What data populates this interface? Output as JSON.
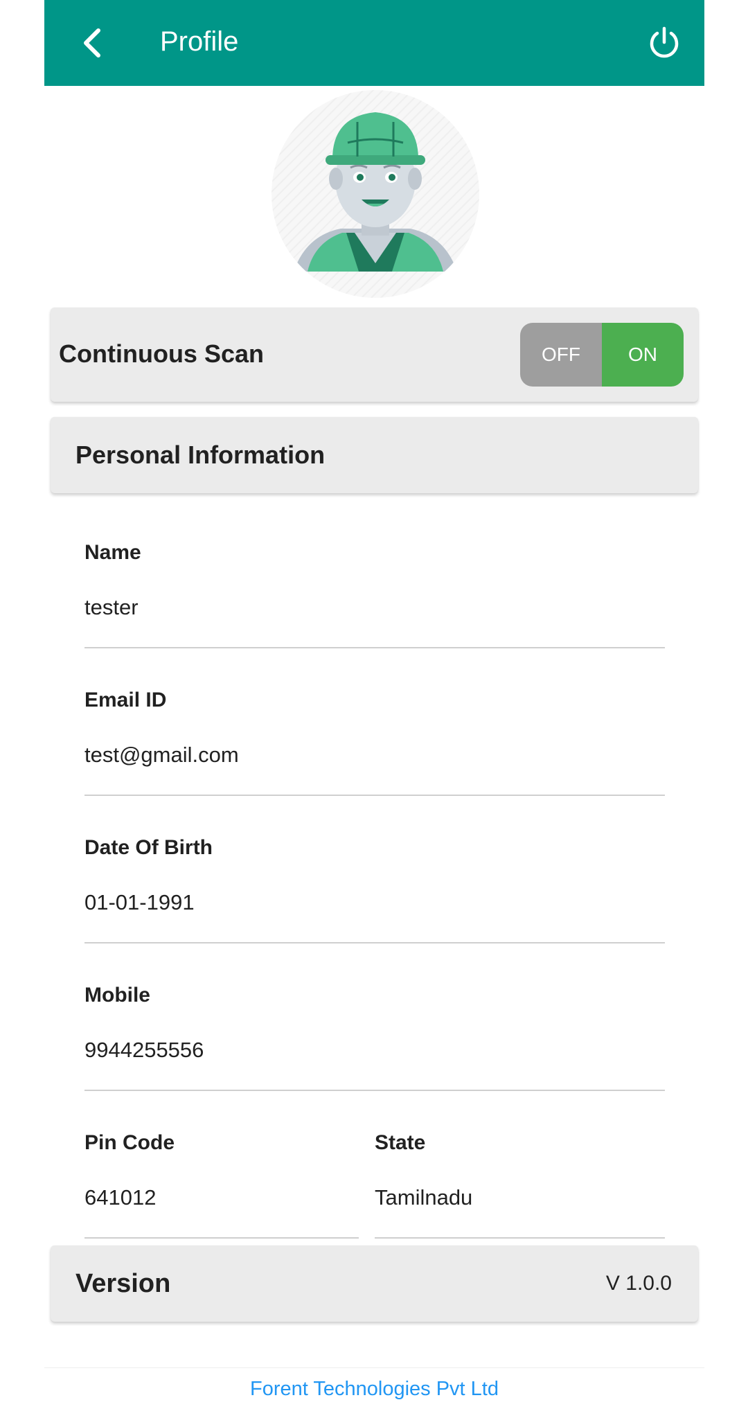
{
  "header": {
    "title": "Profile",
    "back_icon": "chevron-left-icon",
    "power_icon": "power-icon",
    "color": "#009688"
  },
  "continuous_scan": {
    "label": "Continuous Scan",
    "off_label": "OFF",
    "on_label": "ON",
    "state": "ON",
    "off_color": "#9e9e9e",
    "on_color": "#4caf50"
  },
  "personal": {
    "title": "Personal Information",
    "fields": {
      "name": {
        "label": "Name",
        "value": "tester"
      },
      "email": {
        "label": "Email ID",
        "value": "test@gmail.com"
      },
      "dob": {
        "label": "Date Of Birth",
        "value": "01-01-1991"
      },
      "mobile": {
        "label": "Mobile",
        "value": "9944255556"
      },
      "pin": {
        "label": "Pin Code",
        "value": "641012"
      },
      "state": {
        "label": "State",
        "value": "Tamilnadu"
      }
    }
  },
  "version": {
    "label": "Version",
    "value": "V 1.0.0"
  },
  "footer": {
    "text": "Forent Technologies Pvt Ltd",
    "color": "#2196f3"
  }
}
